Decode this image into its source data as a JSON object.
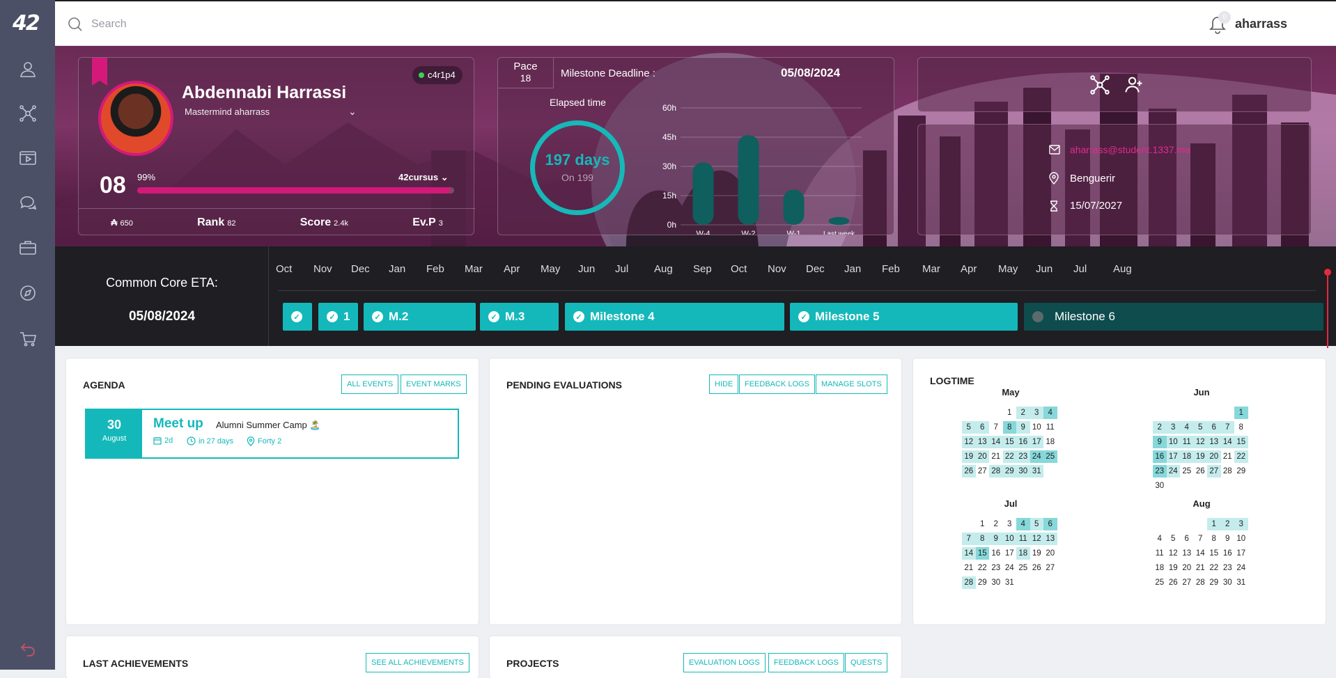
{
  "app": {
    "logo": "42"
  },
  "search": {
    "placeholder": "Search"
  },
  "header": {
    "username": "aharrass",
    "notifications_count": "0"
  },
  "nav": {
    "items": [
      "profile-icon",
      "network-icon",
      "video-icon",
      "chat-icon",
      "briefcase-icon",
      "compass-icon",
      "cart-icon",
      "logout-icon"
    ]
  },
  "profile": {
    "name": "Abdennabi Harrassi",
    "title": "Mastermind aharrass",
    "location_badge": "c4r1p4",
    "level": "08",
    "level_percent": "99%",
    "level_progress": 0.99,
    "cursus": "42cursus",
    "stats": [
      {
        "label": "₳",
        "value": "650"
      },
      {
        "label": "Rank",
        "value": "82"
      },
      {
        "label": "Score",
        "value": "2.4k"
      },
      {
        "label": "Ev.P",
        "value": "3"
      }
    ]
  },
  "pace": {
    "label": "Pace",
    "value": "18",
    "deadline_label": "Milestone Deadline :",
    "deadline_value": "05/08/2024",
    "elapsed_label": "Elapsed time",
    "days": "197 days",
    "days_on": "On 199"
  },
  "chart_data": {
    "type": "bar",
    "categories": [
      "W-4",
      "W-2",
      "W-1",
      "Last week"
    ],
    "values": [
      32,
      46,
      18,
      4
    ],
    "yticks": [
      "60h",
      "45h",
      "30h",
      "15h",
      "0h"
    ],
    "ylim": [
      0,
      60
    ]
  },
  "contact": {
    "email": "aharrass@student.1337.ma",
    "location": "Benguerir",
    "date": "15/07/2027"
  },
  "timeline": {
    "eta_label": "Common Core ETA:",
    "eta_value": "05/08/2024",
    "months": [
      "Oct",
      "Nov",
      "Dec",
      "Jan",
      "Feb",
      "Mar",
      "Apr",
      "May",
      "Jun",
      "Jul",
      "Aug",
      "Sep",
      "Oct",
      "Nov",
      "Dec",
      "Jan",
      "Feb",
      "Mar",
      "Apr",
      "May",
      "Jun",
      "Jul",
      "Aug"
    ],
    "milestones": [
      {
        "label": "",
        "done": true
      },
      {
        "label": "1",
        "done": true
      },
      {
        "label": "M.2",
        "done": true
      },
      {
        "label": "M.3",
        "done": true
      },
      {
        "label": "Milestone 4",
        "done": true
      },
      {
        "label": "Milestone 5",
        "done": true
      },
      {
        "label": "Milestone 6",
        "done": false
      }
    ]
  },
  "agenda": {
    "title": "AGENDA",
    "buttons": [
      "ALL EVENTS",
      "EVENT MARKS"
    ],
    "event": {
      "day": "30",
      "month": "August",
      "type": "Meet up",
      "name": "Alumni Summer Camp 🏝️",
      "duration": "2d",
      "starts_in": "in 27 days",
      "place": "Forty 2"
    }
  },
  "evaluations": {
    "title": "PENDING EVALUATIONS",
    "buttons": [
      "HIDE",
      "FEEDBACK LOGS",
      "MANAGE SLOTS"
    ]
  },
  "logtime": {
    "title": "LOGTIME",
    "months": [
      {
        "name": "May",
        "offset": 3,
        "days": 31,
        "l1": [
          2,
          3,
          5,
          6,
          9,
          12,
          13,
          14,
          15,
          16,
          17,
          19,
          20,
          22,
          23,
          24,
          25,
          26,
          28,
          29,
          30,
          31
        ],
        "l2": [
          4,
          8,
          24,
          25
        ]
      },
      {
        "name": "Jun",
        "offset": 6,
        "days": 30,
        "l1": [
          2,
          3,
          4,
          5,
          6,
          7,
          10,
          11,
          12,
          13,
          14,
          15,
          17,
          18,
          19,
          20,
          22,
          24,
          27
        ],
        "l2": [
          1,
          9,
          16,
          23
        ]
      },
      {
        "name": "Jul",
        "offset": 1,
        "days": 31,
        "l1": [
          4,
          5,
          6,
          7,
          8,
          9,
          10,
          11,
          12,
          13,
          14,
          15,
          18,
          28
        ],
        "l2": [
          4,
          6,
          15
        ]
      },
      {
        "name": "Aug",
        "offset": 4,
        "days": 31,
        "l1": [
          1,
          2,
          3
        ],
        "l2": []
      }
    ]
  },
  "achievements": {
    "title": "LAST ACHIEVEMENTS",
    "button": "SEE ALL ACHIEVEMENTS"
  },
  "projects": {
    "title": "PROJECTS",
    "buttons": [
      "EVALUATION LOGS",
      "FEEDBACK LOGS",
      "QUESTS"
    ]
  },
  "colors": {
    "accent": "#14b8ba",
    "brand": "#d4197a",
    "sidebar": "#4c5066",
    "timeline_bg": "#1e1e23"
  }
}
